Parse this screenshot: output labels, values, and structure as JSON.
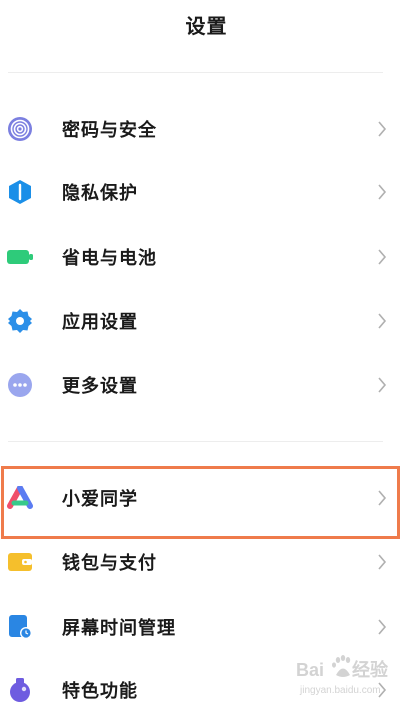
{
  "header": {
    "title": "设置"
  },
  "groups": [
    {
      "items": [
        {
          "label": "密码与安全",
          "icon": "fingerprint-icon",
          "color": "#7b7fe0"
        },
        {
          "label": "隐私保护",
          "icon": "privacy-shield-icon",
          "color": "#1b8fe8"
        },
        {
          "label": "省电与电池",
          "icon": "battery-icon",
          "color": "#2ecb7a"
        },
        {
          "label": "应用设置",
          "icon": "gear-icon",
          "color": "#2b8fe8"
        },
        {
          "label": "更多设置",
          "icon": "more-dots-icon",
          "color": "#9aa6ee"
        }
      ]
    },
    {
      "items": [
        {
          "label": "小爱同学",
          "icon": "xiaoai-icon",
          "highlighted": true,
          "highlight_color": "#ef7b4b"
        },
        {
          "label": "钱包与支付",
          "icon": "wallet-icon",
          "color": "#f5bf2c"
        },
        {
          "label": "屏幕时间管理",
          "icon": "screen-time-icon",
          "color": "#2a86e3"
        },
        {
          "label": "特色功能",
          "icon": "feature-flask-icon",
          "color": "#6e5ce0"
        }
      ]
    }
  ],
  "watermark": {
    "text": "Baidu经验",
    "subtext": "jingyan.baidu.com"
  }
}
